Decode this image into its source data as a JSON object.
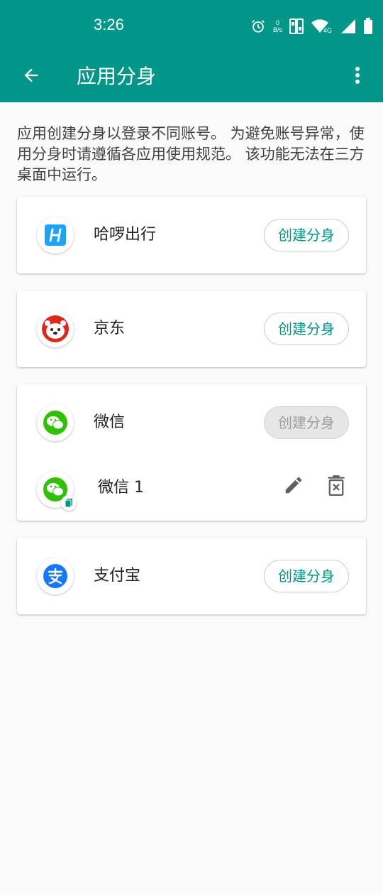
{
  "status_bar": {
    "time": "3:26",
    "net_speed_value": "0",
    "net_speed_unit": "B/s",
    "network_type": "4G",
    "icons": [
      "alarm-icon",
      "net-speed-indicator",
      "sim-icon",
      "wifi-icon",
      "signal-icon",
      "battery-icon"
    ]
  },
  "toolbar": {
    "title": "应用分身",
    "back_icon": "arrow-back-icon",
    "more_icon": "more-vert-icon",
    "background_color": "#009688"
  },
  "description": "应用创建分身以登录不同账号。 为避免账号异常，使用分身时请遵循各应用使用规范。 该功能无法在三方桌面中运行。",
  "apps": [
    {
      "name": "哈啰出行",
      "icon": "hellobike-icon",
      "button_label": "创建分身",
      "button_enabled": true
    },
    {
      "name": "京东",
      "icon": "jd-icon",
      "button_label": "创建分身",
      "button_enabled": true
    },
    {
      "name": "微信",
      "icon": "wechat-icon",
      "button_label": "创建分身",
      "button_enabled": false,
      "clones": [
        {
          "name": "微信 1",
          "icon": "wechat-clone-icon",
          "edit_icon": "edit-icon",
          "delete_icon": "delete-icon"
        }
      ]
    },
    {
      "name": "支付宝",
      "icon": "alipay-icon",
      "button_label": "创建分身",
      "button_enabled": true
    }
  ],
  "colors": {
    "accent": "#009688",
    "disabled_button_bg": "#e6e6e6",
    "disabled_button_text": "#9e9e9e"
  }
}
